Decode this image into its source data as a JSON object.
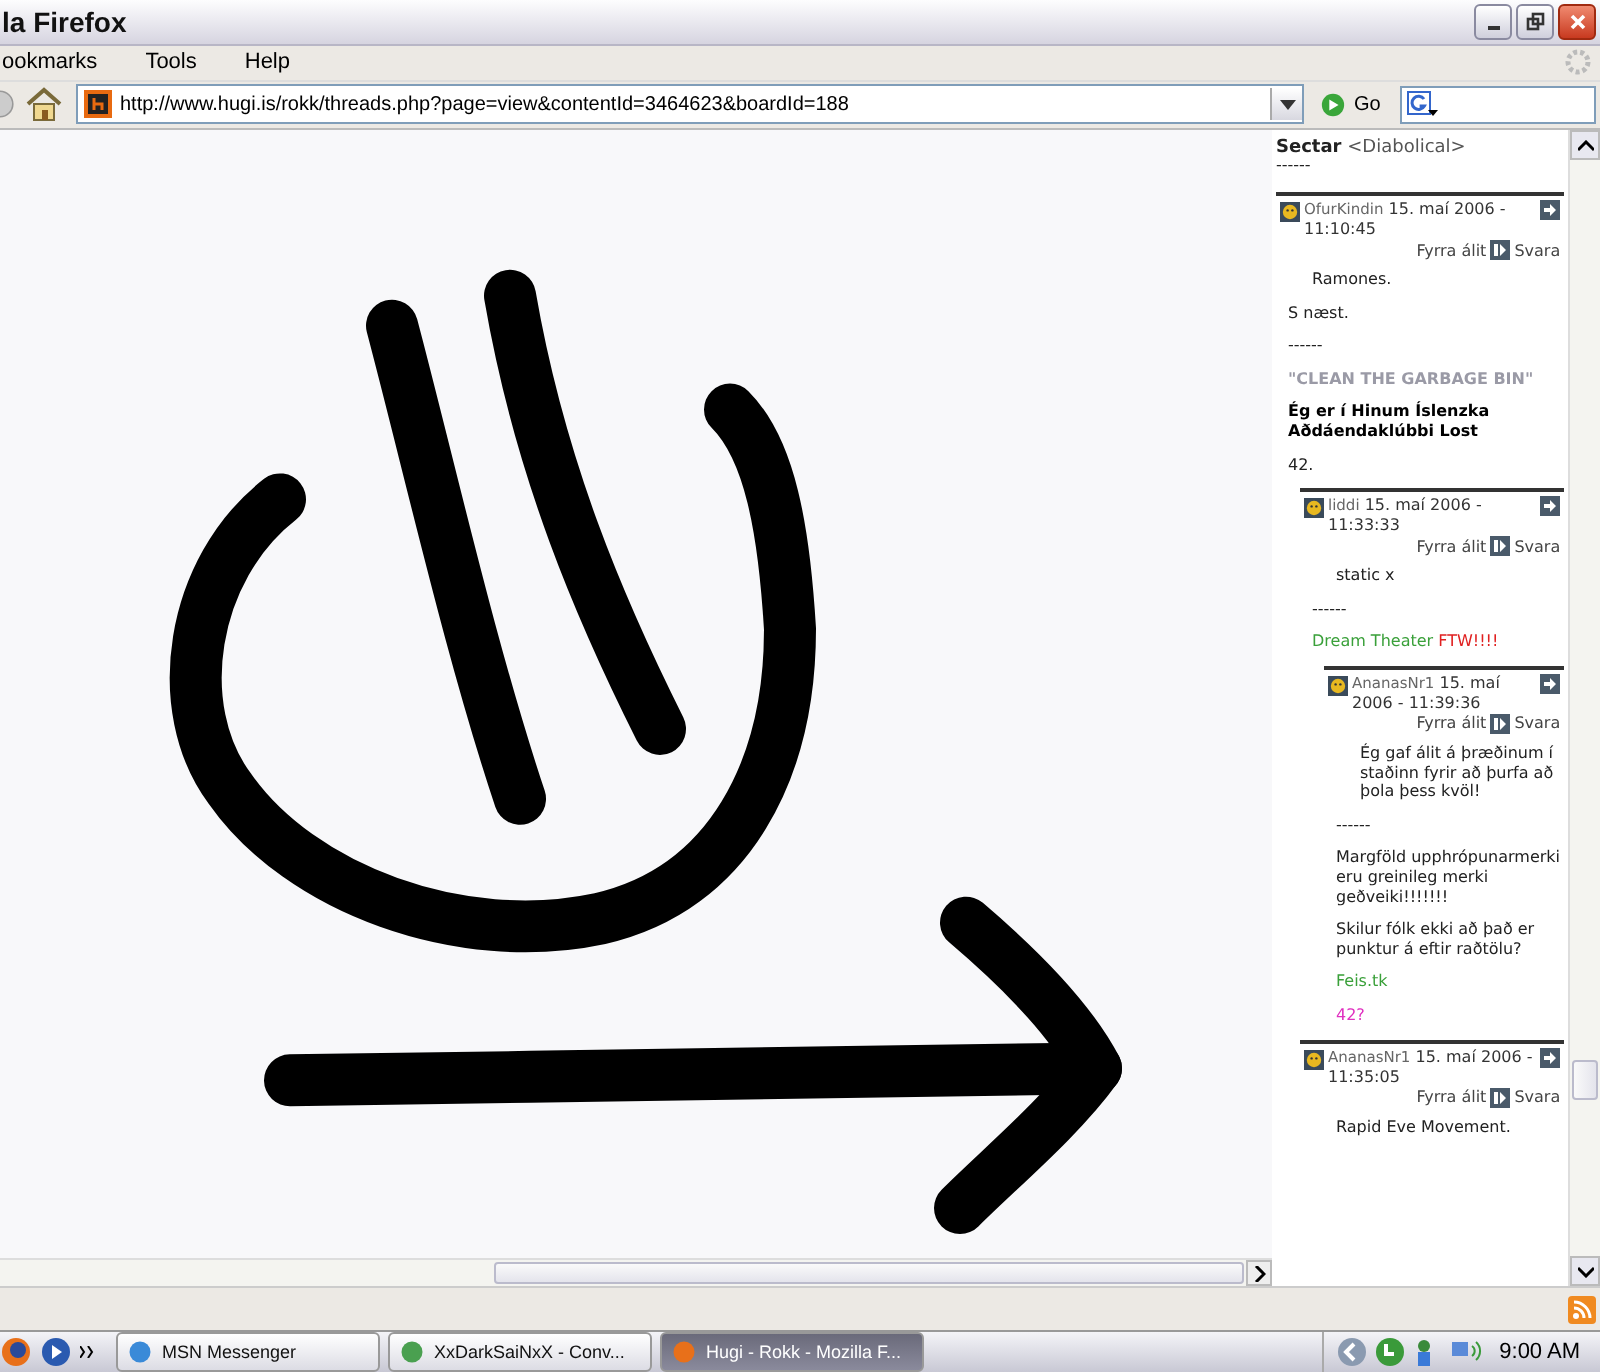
{
  "window": {
    "title": "la Firefox"
  },
  "menu": [
    "ookmarks",
    "Tools",
    "Help"
  ],
  "address": {
    "value": "http://www.hugi.is/rokk/threads.php?page=view&contentId=3464623&boardId=188"
  },
  "go_label": "Go",
  "thread": {
    "author": "Sectar",
    "tag": "<Diabolical>",
    "separator": "------",
    "posts": [
      {
        "author": "OfurKindin",
        "date": "15. maí 2006 - 11:10:45",
        "actions": [
          "Fyrra álit",
          "Svara"
        ],
        "body": [
          [
            {
              "kind": "indent",
              "text": "Ramones."
            }
          ],
          [
            {
              "kind": "plain",
              "text": "S næst."
            }
          ],
          [
            {
              "kind": "plain",
              "text": "------"
            }
          ],
          [
            {
              "kind": "faint",
              "text": "\"CLEAN THE GARBAGE BIN\""
            }
          ],
          [
            {
              "kind": "bold",
              "text": "Ég er í Hinum Íslenzka Aðdáendaklúbbi Lost"
            }
          ],
          [
            {
              "kind": "plain",
              "text": "42."
            }
          ]
        ],
        "children": [
          {
            "author": "liddi",
            "date": "15. maí 2006 - 11:33:33",
            "actions": [
              "Fyrra álit",
              "Svara"
            ],
            "body": [
              [
                {
                  "kind": "indent",
                  "text": "static x"
                }
              ],
              [
                {
                  "kind": "plain",
                  "text": "------"
                }
              ],
              [
                {
                  "kind": "green",
                  "text": "Dream Theater "
                },
                {
                  "kind": "red",
                  "text": "FTW!!!!"
                }
              ]
            ],
            "children": [
              {
                "author": "AnanasNr1",
                "date": "15. maí 2006 - 11:39:36",
                "actions": [
                  "Fyrra álit",
                  "Svara"
                ],
                "body": [
                  [
                    {
                      "kind": "indent",
                      "text": "Ég gaf álit á þræðinum í staðinn fyrir að þurfa að þola þess kvöl!"
                    }
                  ],
                  [
                    {
                      "kind": "plain",
                      "text": "------"
                    }
                  ],
                  [
                    {
                      "kind": "plain",
                      "text": "Margföld upphrópunarmerki eru greinileg merki geðveiki!!!!!!!"
                    }
                  ],
                  [
                    {
                      "kind": "plain",
                      "text": "Skilur fólk ekki að það er punktur á eftir raðtölu?"
                    }
                  ],
                  [
                    {
                      "kind": "green",
                      "text": "Feis.tk"
                    }
                  ],
                  [
                    {
                      "kind": "magenta",
                      "text": "42?"
                    }
                  ]
                ]
              }
            ]
          },
          {
            "author": "AnanasNr1",
            "date": "15. maí 2006 - 11:35:05",
            "actions": [
              "Fyrra álit",
              "Svara"
            ],
            "body": [
              [
                {
                  "kind": "indent",
                  "text": "Rapid Eve Movement."
                }
              ]
            ]
          }
        ]
      }
    ]
  },
  "taskbar": {
    "tasks": [
      {
        "label": "MSN Messenger",
        "selected": false
      },
      {
        "label": "XxDarkSaiNxX - Conv...",
        "selected": false
      },
      {
        "label": "Hugi - Rokk - Mozilla F...",
        "selected": true
      }
    ],
    "clock": "9:00 AM"
  }
}
